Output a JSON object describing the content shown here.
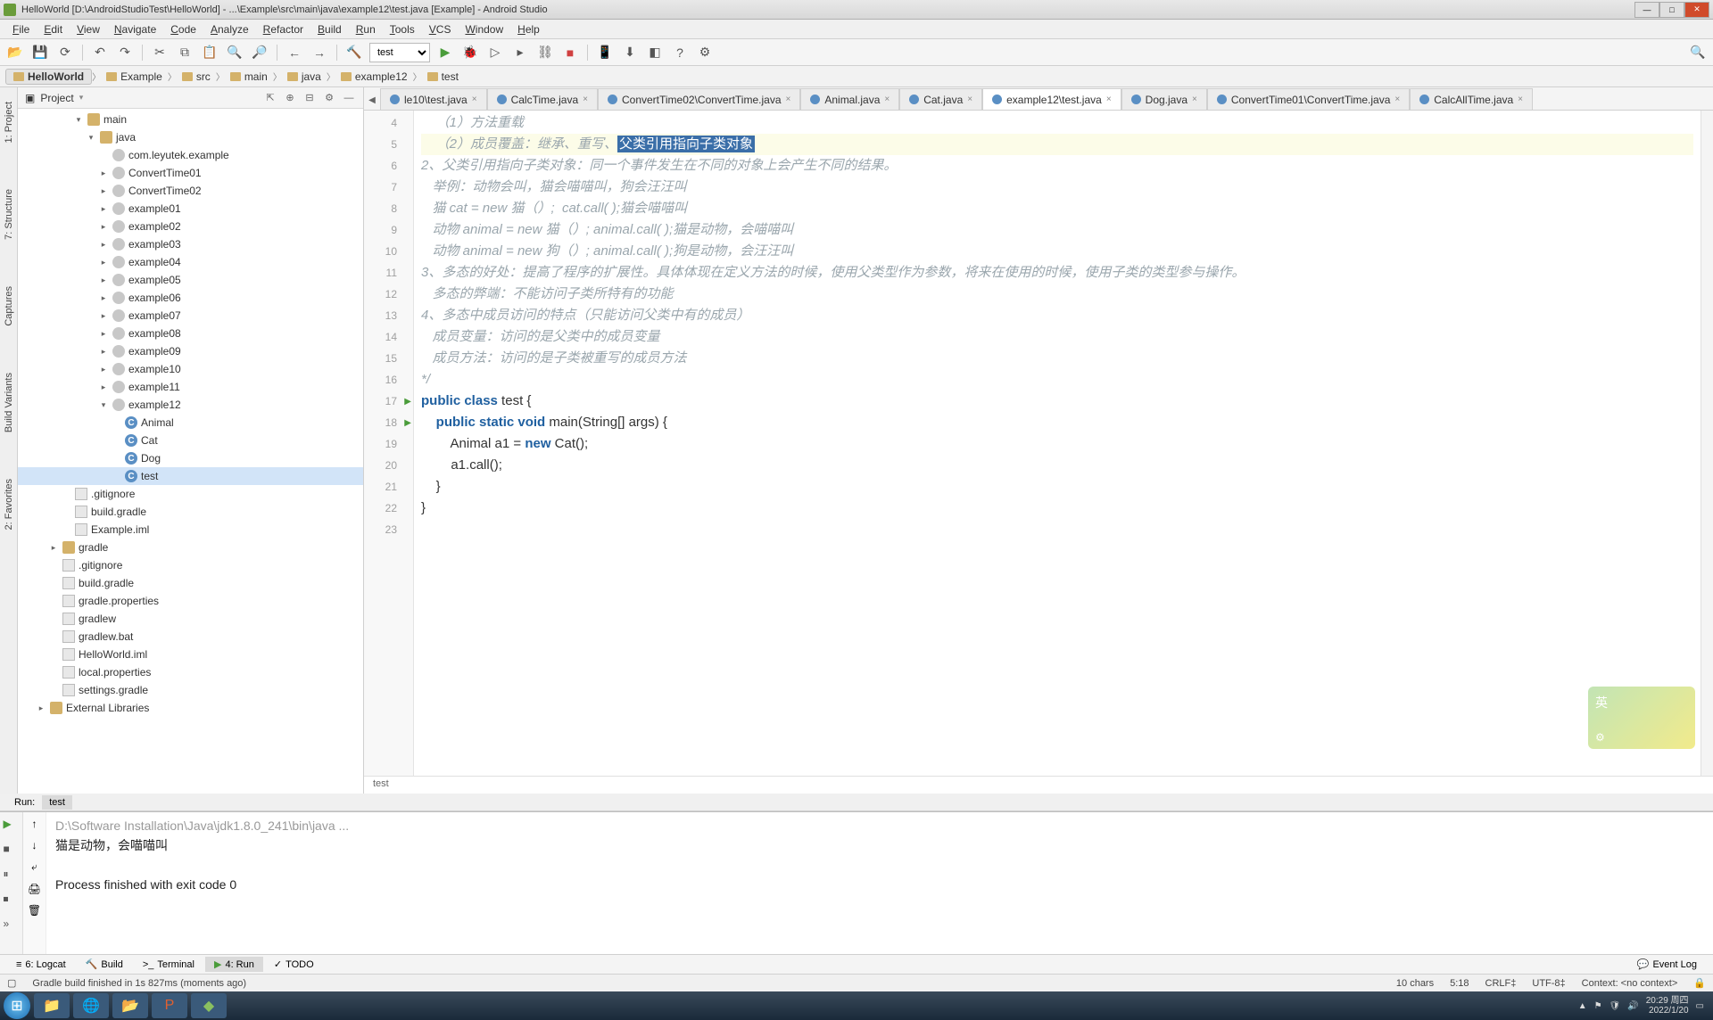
{
  "window": {
    "title": "HelloWorld [D:\\AndroidStudioTest\\HelloWorld] - ...\\Example\\src\\main\\java\\example12\\test.java [Example] - Android Studio"
  },
  "menu": [
    "File",
    "Edit",
    "View",
    "Navigate",
    "Code",
    "Analyze",
    "Refactor",
    "Build",
    "Run",
    "Tools",
    "VCS",
    "Window",
    "Help"
  ],
  "toolbar": {
    "run_config": "test"
  },
  "breadcrumbs": [
    "HelloWorld",
    "Example",
    "src",
    "main",
    "java",
    "example12",
    "test"
  ],
  "project": {
    "header": "Project",
    "tree": {
      "main": "main",
      "java": "java",
      "pkg": "com.leyutek.example",
      "ct01": "ConvertTime01",
      "ct02": "ConvertTime02",
      "ex01": "example01",
      "ex02": "example02",
      "ex03": "example03",
      "ex04": "example04",
      "ex05": "example05",
      "ex06": "example06",
      "ex07": "example07",
      "ex08": "example08",
      "ex09": "example09",
      "ex10": "example10",
      "ex11": "example11",
      "ex12": "example12",
      "animal": "Animal",
      "cat": "Cat",
      "dog": "Dog",
      "test": "test",
      "gitignore": ".gitignore",
      "buildgradle": "build.gradle",
      "exampleiml": "Example.iml",
      "gradle": "gradle",
      "gitignore2": ".gitignore",
      "buildgradle2": "build.gradle",
      "gradleprops": "gradle.properties",
      "gradlew": "gradlew",
      "gradlewbat": "gradlew.bat",
      "helloiml": "HelloWorld.iml",
      "localprops": "local.properties",
      "settingsgradle": "settings.gradle",
      "extlib": "External Libraries"
    }
  },
  "side_tabs": {
    "project": "1: Project",
    "structure": "7: Structure",
    "captures": "Captures",
    "buildvariants": "Build Variants",
    "favorites": "2: Favorites"
  },
  "editor_tabs": [
    "le10\\test.java",
    "CalcTime.java",
    "ConvertTime02\\ConvertTime.java",
    "Animal.java",
    "Cat.java",
    "example12\\test.java",
    "Dog.java",
    "ConvertTime01\\ConvertTime.java",
    "CalcAllTime.java"
  ],
  "active_tab_index": 5,
  "code": {
    "line_start": 4,
    "lines": [
      {
        "n": 4,
        "type": "cmt",
        "text": "    （1）方法重载"
      },
      {
        "n": 5,
        "type": "cmt-hl",
        "pre": "    （2）成员覆盖：继承、重写、",
        "hl": "父类引用指向子类对象"
      },
      {
        "n": 6,
        "type": "cmt",
        "text": "2、父类引用指向子类对象：同一个事件发生在不同的对象上会产生不同的结果。"
      },
      {
        "n": 7,
        "type": "cmt",
        "text": "   举例：动物会叫，猫会喵喵叫，狗会汪汪叫"
      },
      {
        "n": 8,
        "type": "cmt",
        "text": "   猫 cat = new 猫（）;  cat.call( );猫会喵喵叫"
      },
      {
        "n": 9,
        "type": "cmt",
        "text": "   动物 animal = new 猫（）; animal.call( );猫是动物，会喵喵叫"
      },
      {
        "n": 10,
        "type": "cmt",
        "text": "   动物 animal = new 狗（）; animal.call( );狗是动物，会汪汪叫"
      },
      {
        "n": 11,
        "type": "cmt",
        "text": "3、多态的好处：提高了程序的扩展性。具体体现在定义方法的时候，使用父类型作为参数，将来在使用的时候，使用子类的类型参与操作。"
      },
      {
        "n": 12,
        "type": "cmt",
        "text": "   多态的弊端：不能访问子类所特有的功能"
      },
      {
        "n": 13,
        "type": "cmt",
        "text": "4、多态中成员访问的特点（只能访问父类中有的成员）"
      },
      {
        "n": 14,
        "type": "cmt",
        "text": "   成员变量：访问的是父类中的成员变量"
      },
      {
        "n": 15,
        "type": "cmt",
        "text": "   成员方法：访问的是子类被重写的成员方法"
      },
      {
        "n": 16,
        "type": "cmt",
        "text": "*/"
      },
      {
        "n": 17,
        "type": "code",
        "html": "<span class='kw'>public</span> <span class='kw'>class</span> test {",
        "run": true
      },
      {
        "n": 18,
        "type": "code",
        "html": "    <span class='kw'>public</span> <span class='kw'>static</span> <span class='kw'>void</span> main(String[] args) {",
        "run": true
      },
      {
        "n": 19,
        "type": "code",
        "html": "        Animal a1 = <span class='kw'>new</span> Cat();"
      },
      {
        "n": 20,
        "type": "code",
        "html": "        a1.call();"
      },
      {
        "n": 21,
        "type": "code",
        "html": "    }"
      },
      {
        "n": 22,
        "type": "code",
        "html": "}"
      },
      {
        "n": 23,
        "type": "code",
        "html": ""
      }
    ],
    "footer_crumb": "test"
  },
  "run": {
    "tab1": "Run:",
    "tab2": "test",
    "lines": [
      {
        "cls": "out-gray",
        "text": "D:\\Software Installation\\Java\\jdk1.8.0_241\\bin\\java ..."
      },
      {
        "cls": "out-norm",
        "text": "猫是动物，会喵喵叫"
      },
      {
        "cls": "out-norm",
        "text": ""
      },
      {
        "cls": "out-norm",
        "text": "Process finished with exit code 0"
      }
    ]
  },
  "bottom_tabs": {
    "logcat": "6: Logcat",
    "build": "Build",
    "terminal": "Terminal",
    "run": "4: Run",
    "todo": "TODO",
    "eventlog": "Event Log"
  },
  "status": {
    "msg": "Gradle build finished in 1s 827ms (moments ago)",
    "chars": "10 chars",
    "pos": "5:18",
    "crlf": "CRLF‡",
    "enc": "UTF-8‡",
    "context": "Context: <no context>"
  },
  "taskbar": {
    "time": "20:29 周四",
    "date": "2022/1/20"
  }
}
